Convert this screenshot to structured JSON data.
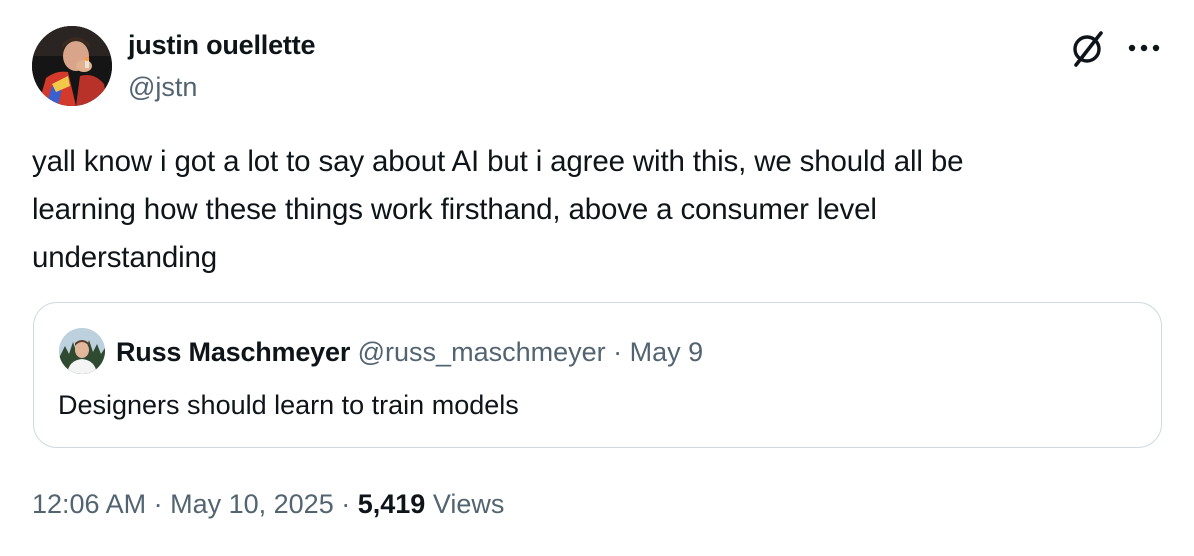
{
  "author": {
    "name": "justin ouellette",
    "handle": "@jstn"
  },
  "header_actions": {
    "grok_icon": "grok-icon",
    "more_icon": "more-icon"
  },
  "tweet": {
    "text": "yall know i got a lot to say about AI but i agree with this, we should all be\nlearning how these things work firsthand, above a consumer level\nunderstanding"
  },
  "quote": {
    "name": "Russ Maschmeyer",
    "handle": "@russ_maschmeyer",
    "separator": "·",
    "date": "May 9",
    "text": "Designers should learn to train models"
  },
  "meta": {
    "time": "12:06 AM",
    "separator": "·",
    "date": "May 10, 2025",
    "views_count": "5,419",
    "views_label": "Views"
  },
  "colors": {
    "text_primary": "#0f1419",
    "text_secondary": "#536471",
    "border": "#cfd9de"
  }
}
